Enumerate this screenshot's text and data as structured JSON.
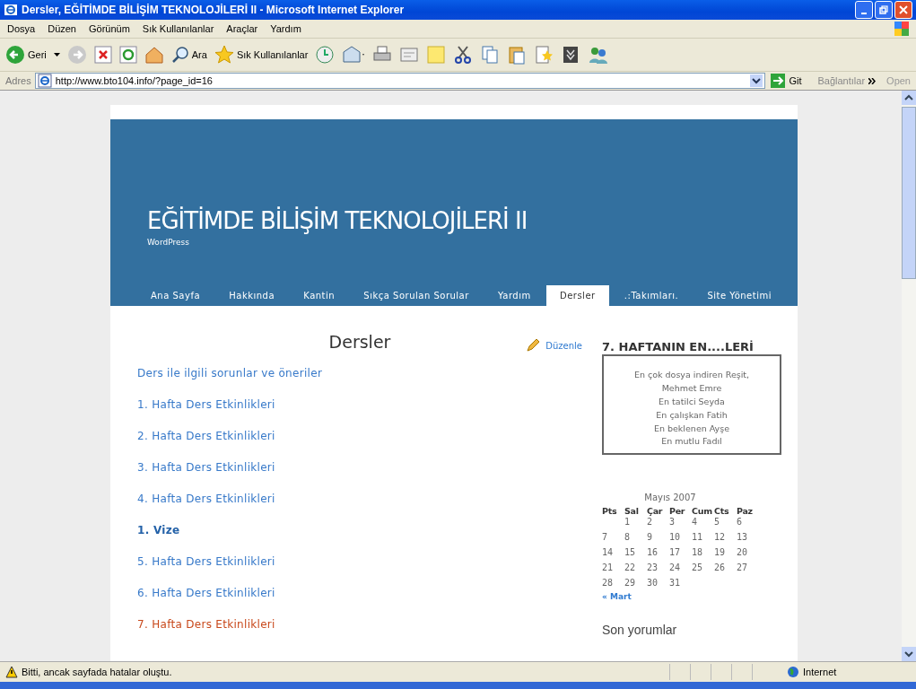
{
  "window": {
    "title": "Dersler, EĞİTİMDE BİLİŞİM TEKNOLOJİLERİ II - Microsoft Internet Explorer"
  },
  "menu": [
    "Dosya",
    "Düzen",
    "Görünüm",
    "Sık Kullanılanlar",
    "Araçlar",
    "Yardım"
  ],
  "toolbar": {
    "back": "Geri",
    "search": "Ara",
    "favorites": "Sık Kullanılanlar"
  },
  "address": {
    "label": "Adres",
    "url": "http://www.bto104.info/?page_id=16",
    "go": "Git",
    "links": "Bağlantılar",
    "extra": "Open"
  },
  "site": {
    "title": "EĞİTİMDE BİLİŞİM TEKNOLOJİLERİ II",
    "tagline": "WordPress"
  },
  "nav": [
    {
      "label": "Ana Sayfa",
      "selected": false
    },
    {
      "label": "Hakkında",
      "selected": false
    },
    {
      "label": "Kantin",
      "selected": false
    },
    {
      "label": "Sıkça Sorulan Sorular",
      "selected": false
    },
    {
      "label": "Yardım",
      "selected": false
    },
    {
      "label": "Dersler",
      "selected": true
    },
    {
      "label": ".:Takımları.",
      "selected": false
    },
    {
      "label": "Site Yönetimi",
      "selected": false
    }
  ],
  "post": {
    "title": "Dersler",
    "edit": "Düzenle",
    "links": [
      {
        "text": "Ders ile ilgili sorunlar ve öneriler",
        "kind": "normal"
      },
      {
        "text": "1. Hafta Ders Etkinlikleri",
        "kind": "normal"
      },
      {
        "text": "2. Hafta Ders Etkinlikleri",
        "kind": "normal"
      },
      {
        "text": "3. Hafta Ders Etkinlikleri",
        "kind": "normal"
      },
      {
        "text": "4. Hafta Ders Etkinlikleri",
        "kind": "normal"
      },
      {
        "text": "1. Vize",
        "kind": "bold"
      },
      {
        "text": "5. Hafta Ders Etkinlikleri",
        "kind": "normal"
      },
      {
        "text": "6. Hafta Ders Etkinlikleri",
        "kind": "normal"
      },
      {
        "text": "7. Hafta Ders Etkinlikleri",
        "kind": "visited"
      }
    ]
  },
  "sidebar": {
    "widget_title": "7. HAFTANIN EN....LERİ",
    "lines": [
      "En çok dosya indiren Reşit,",
      "Mehmet Emre",
      "En tatilci Seyda",
      "En çalışkan Fatih",
      "En beklenen Ayşe",
      "En mutlu Fadıl"
    ],
    "calendar": {
      "caption": "Mayıs 2007",
      "days": [
        "Pts",
        "Sal",
        "Çar",
        "Per",
        "Cum",
        "Cts",
        "Paz"
      ],
      "weeks": [
        {
          "kind": "first",
          "days": [
            "1",
            "2",
            "3",
            "4",
            "5",
            "6"
          ]
        },
        {
          "kind": "full",
          "days": [
            "7",
            "8",
            "9",
            "10",
            "11",
            "12",
            "13"
          ]
        },
        {
          "kind": "full",
          "days": [
            "14",
            "15",
            "16",
            "17",
            "18",
            "19",
            "20"
          ]
        },
        {
          "kind": "full",
          "days": [
            "21",
            "22",
            "23",
            "24",
            "25",
            "26",
            "27"
          ]
        },
        {
          "kind": "last",
          "days": [
            "28",
            "29",
            "30",
            "31"
          ]
        }
      ],
      "prev": "« Mart"
    },
    "comments_title": "Son yorumlar"
  },
  "status_bar": {
    "text": "Bitti, ancak sayfada hatalar oluştu.",
    "zone": "Internet"
  }
}
